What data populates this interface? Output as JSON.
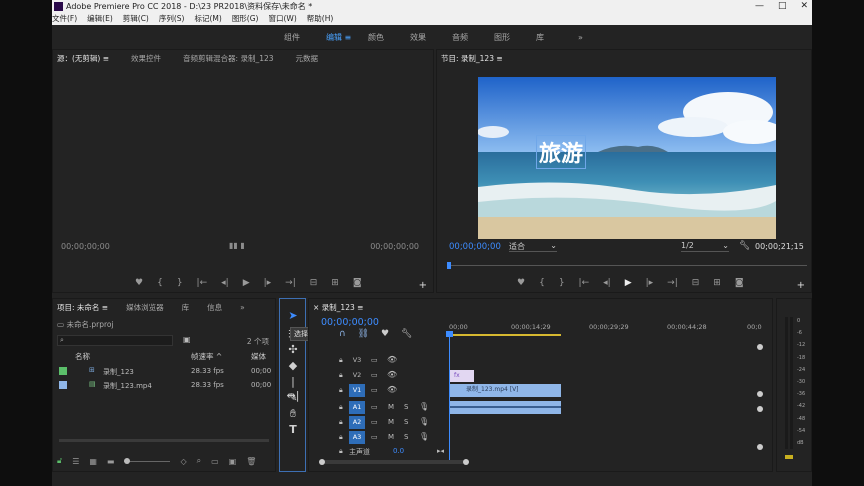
{
  "window": {
    "title": "Adobe Premiere Pro CC 2018 - D:\\23 PR2018\\资料保存\\未命名 *",
    "controls": [
      "—",
      "□",
      "✕"
    ]
  },
  "menu": [
    "文件(F)",
    "编辑(E)",
    "剪辑(C)",
    "序列(S)",
    "标记(M)",
    "图形(G)",
    "窗口(W)",
    "帮助(H)"
  ],
  "workspaces": {
    "items": [
      "组件",
      "编辑",
      "颜色",
      "效果",
      "音频",
      "图形",
      "库"
    ],
    "active": "编辑",
    "more": "»"
  },
  "source_panel": {
    "tabs": [
      "源：(无剪辑)",
      "效果控件",
      "音频剪辑混合器: 录制_123",
      "元数据"
    ],
    "timecode_left": "00;00;00;00",
    "timecode_right": "00;00;00;00"
  },
  "program_panel": {
    "title": "节目: 录制_123",
    "overlay_text": "旅游",
    "timecode": "00;00;00;00",
    "fit": "适合",
    "resolution": "1/2",
    "duration": "00;00;21;15"
  },
  "project_panel": {
    "tabs": [
      "项目: 未命名",
      "媒体浏览器",
      "库",
      "信息"
    ],
    "file": "未命名.prproj",
    "item_count": "2 个项",
    "columns": [
      "名称",
      "帧速率",
      "媒体"
    ],
    "rows": [
      {
        "name": "录制_123",
        "fps": "28.33 fps",
        "start": "00;00",
        "color": "#5bbf6a"
      },
      {
        "name": "录制_123.mp4",
        "fps": "28.33 fps",
        "start": "00;00",
        "color": "#8fb6e8"
      }
    ]
  },
  "tools": {
    "tooltip": "选择工具 (V)"
  },
  "timeline": {
    "sequence": "录制_123",
    "timecode": "00;00;00;00",
    "ruler": [
      "00;00",
      "00;00;14;29",
      "00;00;29;29",
      "00;00;44;28",
      "00;0"
    ],
    "video_tracks": [
      "V3",
      "V2",
      "V1"
    ],
    "audio_tracks": [
      "A1",
      "A2",
      "A3"
    ],
    "master": "主声道",
    "master_value": "0.0",
    "clip_label": "录制_123.mp4 [V]",
    "fx_label": "fx"
  },
  "meter": {
    "labels": [
      "0",
      "-6",
      "-12",
      "-18",
      "-24",
      "-30",
      "-36",
      "-42",
      "-48",
      "-54",
      "dB"
    ]
  }
}
